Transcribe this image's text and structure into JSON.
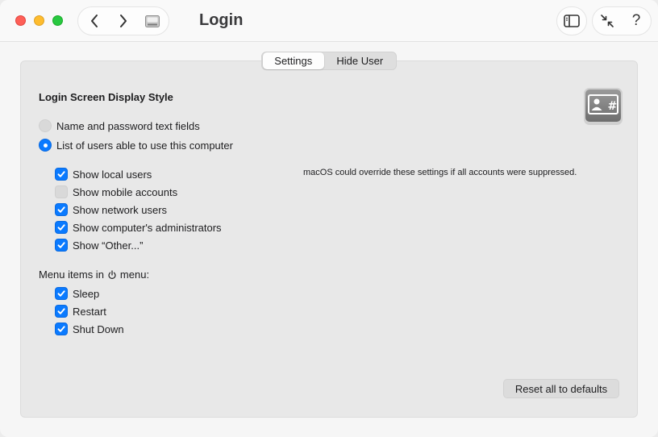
{
  "window": {
    "title": "Login",
    "toolbar": {
      "back_icon": "chevron-left-icon",
      "forward_icon": "chevron-right-icon",
      "grid_icon": "all-settings-grid-icon",
      "sidebar_icon": "sidebar-toggle-icon",
      "collapse_icon": "collapse-arrows-icon",
      "help_label": "?"
    }
  },
  "tabs": [
    {
      "label": "Settings",
      "selected": true
    },
    {
      "label": "Hide User",
      "selected": false
    }
  ],
  "display_style": {
    "title": "Login Screen Display Style",
    "options": [
      {
        "label": "Name and password text fields",
        "selected": false
      },
      {
        "label": "List of users able to use this computer",
        "selected": true
      }
    ]
  },
  "user_list_options": [
    {
      "label": "Show local users",
      "checked": true
    },
    {
      "label": "Show mobile accounts",
      "checked": false
    },
    {
      "label": "Show network users",
      "checked": true
    },
    {
      "label": "Show computer's administrators",
      "checked": true
    },
    {
      "label": "Show “Other...”",
      "checked": true
    }
  ],
  "note": "macOS could override these settings if all accounts were suppressed.",
  "menu_items": {
    "title_before": "Menu items in",
    "title_after": "menu:",
    "items": [
      {
        "label": "Sleep",
        "checked": true
      },
      {
        "label": "Restart",
        "checked": true
      },
      {
        "label": "Shut Down",
        "checked": true
      }
    ]
  },
  "reset_button": "Reset all to defaults",
  "colors": {
    "accent": "#0a7aff",
    "traffic_red": "#fe5f57",
    "traffic_yellow": "#febc2e",
    "traffic_green": "#28c840"
  }
}
